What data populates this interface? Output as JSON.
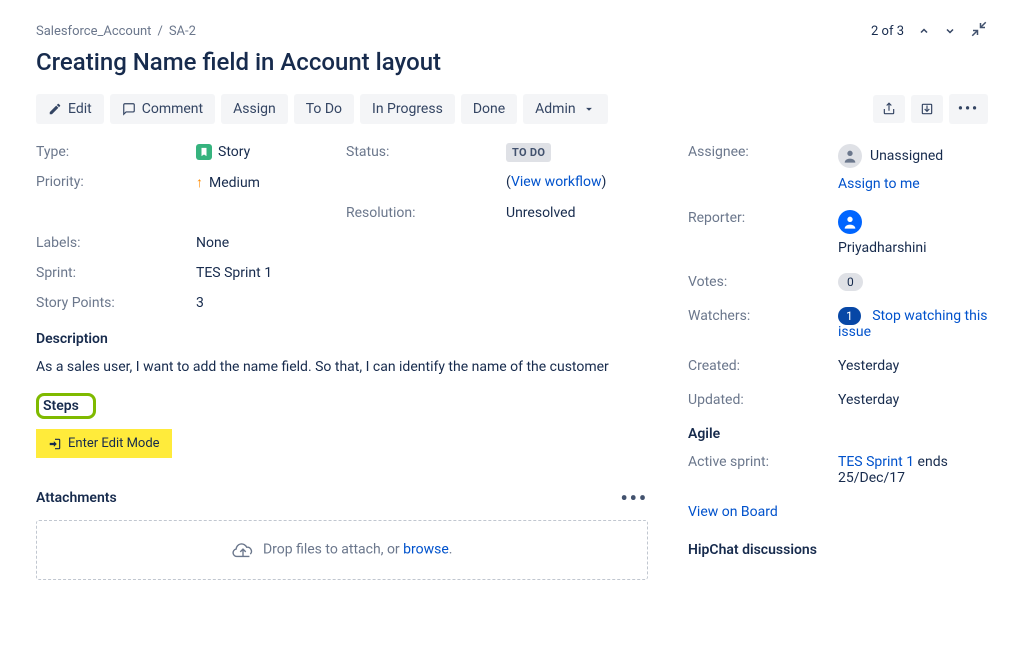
{
  "breadcrumb": {
    "project": "Salesforce_Account",
    "sep": "/",
    "issue_key": "SA-2"
  },
  "pager": "2 of 3",
  "title": "Creating Name field in Account layout",
  "toolbar": {
    "edit": "Edit",
    "comment": "Comment",
    "assign": "Assign",
    "todo": "To Do",
    "in_progress": "In Progress",
    "done": "Done",
    "admin": "Admin"
  },
  "fields": {
    "type_label": "Type:",
    "type_value": "Story",
    "priority_label": "Priority:",
    "priority_value": "Medium",
    "status_label": "Status:",
    "status_lozenge": "TO DO",
    "view_workflow": "View workflow",
    "resolution_label": "Resolution:",
    "resolution_value": "Unresolved",
    "labels_label": "Labels:",
    "labels_value": "None",
    "sprint_label": "Sprint:",
    "sprint_value": "TES Sprint 1",
    "story_points_label": "Story Points:",
    "story_points_value": "3"
  },
  "description": {
    "title": "Description",
    "text": "As a sales user, I want to add the name field. So that, I can identify the name of the customer"
  },
  "steps": {
    "title": "Steps",
    "enter_edit_mode": "Enter Edit Mode"
  },
  "attachments": {
    "title": "Attachments",
    "drop_text": "Drop files to attach, or ",
    "browse": "browse",
    "dot": "."
  },
  "side": {
    "assignee_label": "Assignee:",
    "assignee_value": "Unassigned",
    "assign_to_me": "Assign to me",
    "reporter_label": "Reporter:",
    "reporter_value": "Priyadharshini",
    "votes_label": "Votes:",
    "votes_value": "0",
    "watchers_label": "Watchers:",
    "watchers_count": "1",
    "watchers_action": "Stop watching this issue",
    "created_label": "Created:",
    "created_value": "Yesterday",
    "updated_label": "Updated:",
    "updated_value": "Yesterday",
    "agile_title": "Agile",
    "active_sprint_label": "Active sprint:",
    "active_sprint_link": "TES Sprint 1",
    "active_sprint_suffix": " ends 25/Dec/17",
    "view_on_board": "View on Board",
    "hipchat_title": "HipChat discussions"
  }
}
